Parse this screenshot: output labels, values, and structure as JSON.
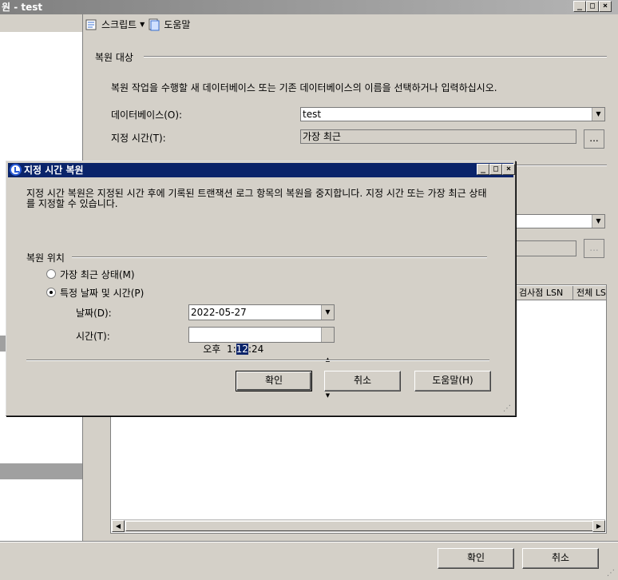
{
  "window": {
    "title": "원 - test"
  },
  "toolbar": {
    "script_label": "스크립트",
    "help_label": "도움말"
  },
  "restore_target": {
    "group_title": "복원 대상",
    "description": "복원 작업을 수행할 새 데이터베이스 또는 기존 데이터베이스의 이름을 선택하거나 입력하십시오.",
    "database_label": "데이터베이스(O):",
    "database_value": "test",
    "point_in_time_label": "지정 시간(T):",
    "point_in_time_value": "가장 최근",
    "browse_label": "..."
  },
  "grid": {
    "columns": [
      "검사점 LSN",
      "전체 LS"
    ]
  },
  "main_buttons": {
    "ok": "확인",
    "cancel": "취소"
  },
  "dialog": {
    "title": "지정 시간 복원",
    "description": "지정 시간 복원은 지정된 시간 후에 기록된 트랜잭션 로그 항목의 복원을 중지합니다. 지정 시간 또는 가장 최근 상태를 지정할 수 있습니다.",
    "restore_to_label": "복원 위치",
    "most_recent_label": "가장 최근 상태(M)",
    "specific_label": "특정 날짜 및 시간(P)",
    "date_label": "날짜(D):",
    "date_value": "2022-05-27",
    "time_label": "시간(T):",
    "time_prefix": "오후  1:",
    "time_selected": "12",
    "time_suffix": ":24",
    "ok_label": "확인",
    "cancel_label": "취소",
    "help_label": "도움말(H)"
  }
}
